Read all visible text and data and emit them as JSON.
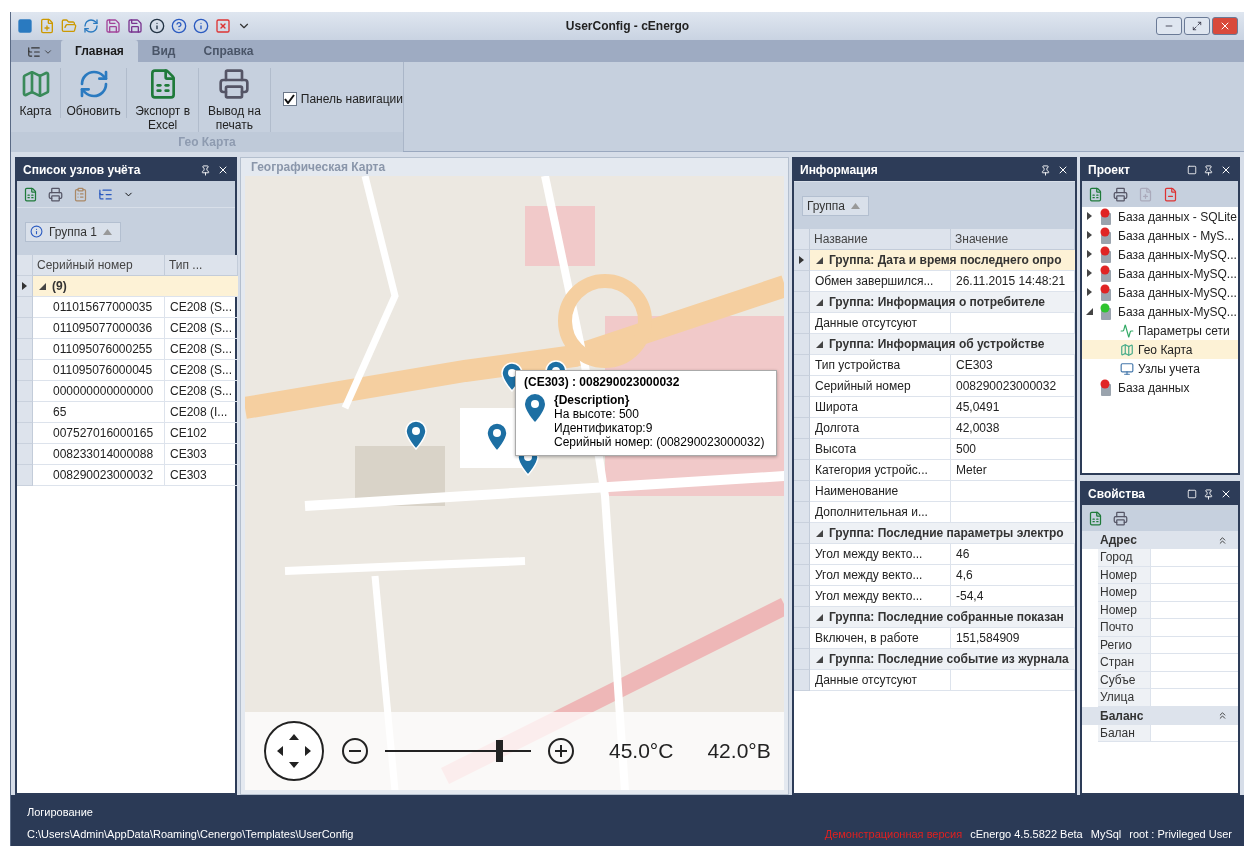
{
  "window": {
    "title": "UserConfig - cEnergo"
  },
  "ribbon": {
    "tabs": [
      {
        "label": "Главная",
        "selected": true
      },
      {
        "label": "Вид",
        "selected": false
      },
      {
        "label": "Справка",
        "selected": false
      }
    ],
    "buttons": [
      {
        "label": "Карта",
        "kind": "map"
      },
      {
        "label": "Обновить",
        "kind": "refresh"
      },
      {
        "label": "Экспорт в Excel",
        "kind": "excel"
      },
      {
        "label": "Вывод на печать",
        "kind": "print"
      }
    ],
    "checkbox": {
      "label": "Панель навигации",
      "checked": true
    },
    "group_label": "Гео Карта"
  },
  "node_list": {
    "title": "Список узлов учёта",
    "group_chip": "Группа 1",
    "columns": [
      "Серийный номер",
      "Тип ..."
    ],
    "group_row": {
      "label": "(9)",
      "expanded": true,
      "selected": true
    },
    "rows": [
      {
        "serial": "011015677000035",
        "type": "CE208 (S..."
      },
      {
        "serial": "011095077000036",
        "type": "CE208 (S..."
      },
      {
        "serial": "011095076000255",
        "type": "CE208 (S..."
      },
      {
        "serial": "011095076000045",
        "type": "CE208 (S..."
      },
      {
        "serial": "000000000000000",
        "type": "CE208 (S..."
      },
      {
        "serial": "65",
        "type": "CE208 (I..."
      },
      {
        "serial": "007527016000165",
        "type": "CE102"
      },
      {
        "serial": "008233014000088",
        "type": "CE303"
      },
      {
        "serial": "008290023000032",
        "type": "CE303"
      }
    ]
  },
  "map": {
    "title": "Географическая Карта",
    "popup": {
      "title": "(CE303) : 008290023000032",
      "heading": "{Description}",
      "lines": [
        "На высоте: 500",
        "Идентификатор:9",
        "Серийный номер: (008290023000032)"
      ]
    },
    "zoom": {
      "level": 0.78
    },
    "readings": [
      "45.0°С",
      "42.0°В"
    ]
  },
  "info": {
    "title": "Информация",
    "group_chip": "Группа",
    "columns": [
      "Название",
      "Значение"
    ],
    "groups": [
      {
        "title": "Группа: Дата и время последнего опро",
        "expanded": true,
        "selected": true,
        "rows": [
          {
            "name": "Обмен завершился...",
            "value": "26.11.2015 14:48:21"
          }
        ]
      },
      {
        "title": "Группа: Информация о потребителе",
        "expanded": true,
        "selected": false,
        "rows": [
          {
            "name": "Данные отсутсуют"
          }
        ]
      },
      {
        "title": "Группа: Информация об устройстве",
        "expanded": true,
        "selected": false,
        "rows": [
          {
            "name": "Тип устройства",
            "value": "CE303"
          },
          {
            "name": "Серийный номер",
            "value": "008290023000032"
          },
          {
            "name": "Широта",
            "value": "45,0491"
          },
          {
            "name": "Долгота",
            "value": "42,0038"
          },
          {
            "name": "Высота",
            "value": "500"
          },
          {
            "name": "Категория устройс...",
            "value": "Meter"
          },
          {
            "name": "Наименование"
          },
          {
            "name": "Дополнительная и..."
          }
        ]
      },
      {
        "title": "Группа: Последние параметры электро",
        "expanded": true,
        "selected": false,
        "rows": [
          {
            "name": "Угол между векто...",
            "value": "46"
          },
          {
            "name": "Угол между векто...",
            "value": "4,6"
          },
          {
            "name": "Угол между векто...",
            "value": "-54,4"
          }
        ]
      },
      {
        "title": "Группа: Последние собранные показан",
        "expanded": true,
        "selected": false,
        "rows": [
          {
            "name": "Включен, в работе",
            "value": "151,584909"
          }
        ]
      },
      {
        "title": "Группа: Последние событие из журнала",
        "expanded": true,
        "selected": false,
        "rows": [
          {
            "name": "Данные отсутсуют"
          }
        ]
      }
    ]
  },
  "project": {
    "title": "Проект",
    "tree": [
      {
        "label": "База данных - SQLite",
        "color": "#e02424",
        "expanded": false
      },
      {
        "label": "База данных - MyS...",
        "color": "#e02424",
        "expanded": false
      },
      {
        "label": "База данных-MySQ...",
        "color": "#e02424",
        "expanded": false
      },
      {
        "label": "База данных-MySQ...",
        "color": "#e02424",
        "expanded": false
      },
      {
        "label": "База данных-MySQ...",
        "color": "#e02424",
        "expanded": false
      },
      {
        "label": "База данных-MySQ...",
        "color": "#2fc42f",
        "expanded": true,
        "children": [
          {
            "label": "Параметры сети",
            "kind": "network",
            "selected": false
          },
          {
            "label": "Гео Карта",
            "kind": "map",
            "selected": true
          },
          {
            "label": "Узлы учета",
            "kind": "nodes",
            "selected": false
          }
        ]
      },
      {
        "label": "База данных",
        "color": "#e02424"
      }
    ]
  },
  "properties": {
    "title": "Свойства",
    "categories": [
      {
        "title": "Адрес",
        "expanded": true,
        "rows": [
          "Город",
          "Номер",
          "Номер",
          "Номер",
          "Почто",
          "Регио",
          "Стран",
          "Субъе",
          "Улица"
        ]
      },
      {
        "title": "Баланс",
        "expanded": true,
        "rows": [
          "Балан"
        ]
      }
    ]
  },
  "status_bar": {
    "log_label": "Логирование",
    "path": "C:\\Users\\Admin\\AppData\\Roaming\\Cenergo\\Templates\\UserConfig",
    "demo": "Демонстрационная версия",
    "version": "cEnergo 4.5.5822 Beta",
    "db": "MySql",
    "user": "root : Privileged User"
  }
}
